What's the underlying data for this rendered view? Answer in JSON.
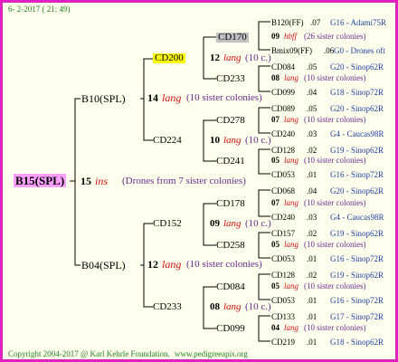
{
  "header": {
    "date": "6- 2-2017 ( 21: 49)"
  },
  "root": {
    "name": "B15(SPL)",
    "num": "15",
    "race": "ins",
    "note": "(Drones from 7 sister colonies)"
  },
  "gen1": [
    {
      "name": "B10(SPL)",
      "num": "14",
      "race": "lang",
      "note": "(10 sister colonies)"
    },
    {
      "name": "B04(SPL)",
      "num": "12",
      "race": "lang",
      "note": "(10 sister colonies)"
    }
  ],
  "gen2": [
    {
      "name": "CD200",
      "num": "12",
      "race": "lang",
      "note": "(10 c.)"
    },
    {
      "name": "CD224",
      "num": "10",
      "race": "lang",
      "note": "(10 c.)"
    },
    {
      "name": "CD152",
      "num": "09",
      "race": "lang",
      "note": "(10 c.)"
    },
    {
      "name": "CD233",
      "num": "08",
      "race": "lang",
      "note": "(10 c.)"
    }
  ],
  "gen3": [
    {
      "name": "CD170",
      "num": "09",
      "race": "hbff",
      "note": "(26 sister colonies)"
    },
    {
      "name": "CD233",
      "num": "08",
      "race": "lang",
      "note": "(10 sister colonies)"
    },
    {
      "name": "CD278",
      "num": "07",
      "race": "lang",
      "note": "(10 sister colonies)"
    },
    {
      "name": "CD241",
      "num": "05",
      "race": "lang",
      "note": "(10 sister colonies)"
    },
    {
      "name": "CD178",
      "num": "07",
      "race": "lang",
      "note": "(10 sister colonies)"
    },
    {
      "name": "CD258",
      "num": "05",
      "race": "lang",
      "note": "(10 sister colonies)"
    },
    {
      "name": "CD084",
      "num": "05",
      "race": "lang",
      "note": "(10 sister colonies)"
    },
    {
      "name": "CD099",
      "num": "04",
      "race": "lang",
      "note": "(10 sister colonies)"
    }
  ],
  "gen4": [
    {
      "name": "B120(FF)",
      "year": ".07",
      "line": "G16 - Adami75R"
    },
    {
      "name": "Bmix09(FF)",
      "year": ".06",
      "line": "G0 - Drones oft"
    },
    {
      "name": "CD084",
      "year": ".05",
      "line": "G20 - Sinop62R"
    },
    {
      "name": "CD099",
      "year": ".04",
      "line": "G18 - Sinop72R"
    },
    {
      "name": "CD089",
      "year": ".05",
      "line": "G20 - Sinop62R"
    },
    {
      "name": "CD240",
      "year": ".03",
      "line": "G4 - Caucas98R"
    },
    {
      "name": "CD128",
      "year": ".02",
      "line": "G19 - Sinop62R"
    },
    {
      "name": "CD053",
      "year": ".01",
      "line": "G16 - Sinop72R"
    },
    {
      "name": "CD068",
      "year": ".04",
      "line": "G20 - Sinop62R"
    },
    {
      "name": "CD240",
      "year": ".03",
      "line": "G4 - Caucas98R"
    },
    {
      "name": "CD157",
      "year": ".02",
      "line": "G19 - Sinop62R"
    },
    {
      "name": "CD053",
      "year": ".01",
      "line": "G16 - Sinop72R"
    },
    {
      "name": "CD128",
      "year": ".02",
      "line": "G19 - Sinop62R"
    },
    {
      "name": "CD053",
      "year": ".01",
      "line": "G16 - Sinop72R"
    },
    {
      "name": "CD133",
      "year": ".01",
      "line": "G17 - Sinop72R"
    },
    {
      "name": "CD219",
      "year": ".01",
      "line": "G18 - Sinop62R"
    }
  ],
  "footer": {
    "copyright": "Copyright 2004-2017 @ Karl Kehrle Foundation.",
    "url": "www.pedigreeapis.org"
  }
}
